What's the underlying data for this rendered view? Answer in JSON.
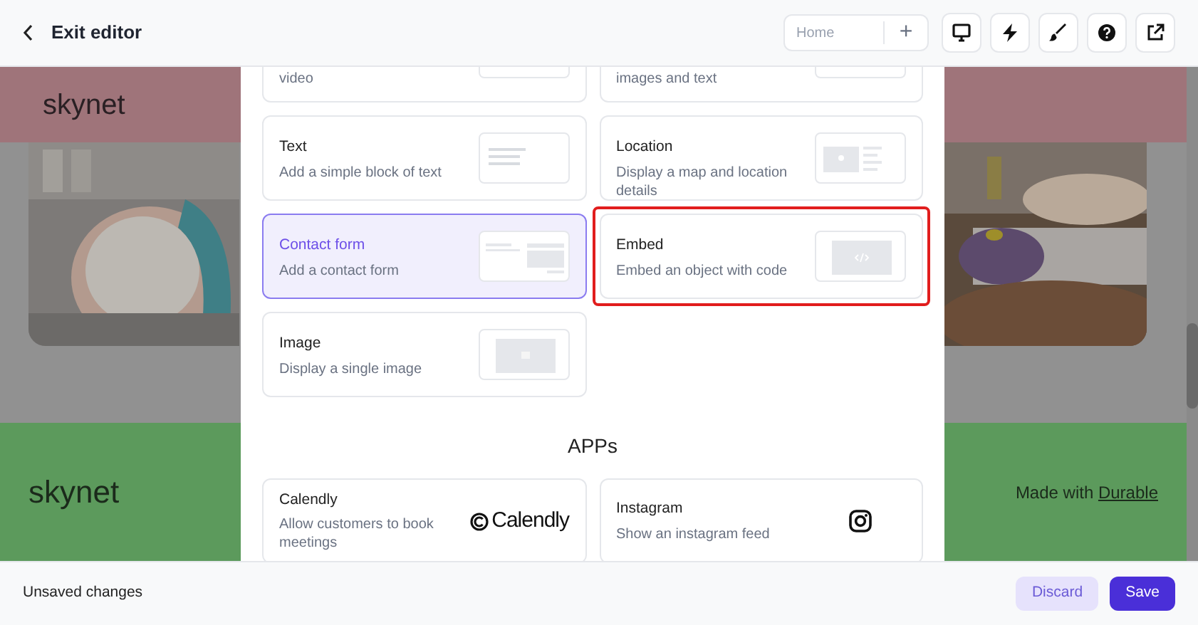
{
  "header": {
    "back_label": "Exit editor",
    "page_selector": {
      "value": "Home",
      "add_label": "+"
    },
    "tools": [
      {
        "kind": "monitor"
      },
      {
        "kind": "bolt"
      },
      {
        "kind": "brush"
      },
      {
        "kind": "help"
      },
      {
        "kind": "external"
      }
    ]
  },
  "site": {
    "brand_top": "skynet",
    "brand_bottom": "skynet",
    "footer_text": "Made with",
    "footer_link": "Durable"
  },
  "sections": {
    "cards": [
      {
        "kind": "partial",
        "description": "video"
      },
      {
        "kind": "partial",
        "description": "images and text"
      },
      {
        "title": "Text",
        "description": "Add a simple block of text",
        "kind": "text",
        "selected": false,
        "highlighted": false
      },
      {
        "title": "Location",
        "description": "Display a map and location details",
        "kind": "location",
        "selected": false,
        "highlighted": false
      },
      {
        "title": "Contact form",
        "description": "Add a contact form",
        "kind": "form",
        "selected": true,
        "highlighted": false
      },
      {
        "title": "Embed",
        "description": "Embed an object with code",
        "kind": "embed",
        "selected": false,
        "highlighted": true
      },
      {
        "title": "Image",
        "description": "Display a single image",
        "selected": false,
        "highlighted": false
      }
    ]
  },
  "apps": {
    "heading": "APPs",
    "cards": [
      {
        "title": "Calendly",
        "description": "Allow customers to book meetings",
        "kind": "calendly",
        "logo_text": "Calendly"
      },
      {
        "title": "Instagram",
        "description": "Show an instagram feed",
        "kind": "instagram"
      }
    ]
  },
  "footer": {
    "status": "Unsaved changes",
    "buttons": [
      {
        "label": "Discard",
        "kind": "secondary"
      },
      {
        "label": "Save",
        "kind": "primary"
      }
    ]
  }
}
